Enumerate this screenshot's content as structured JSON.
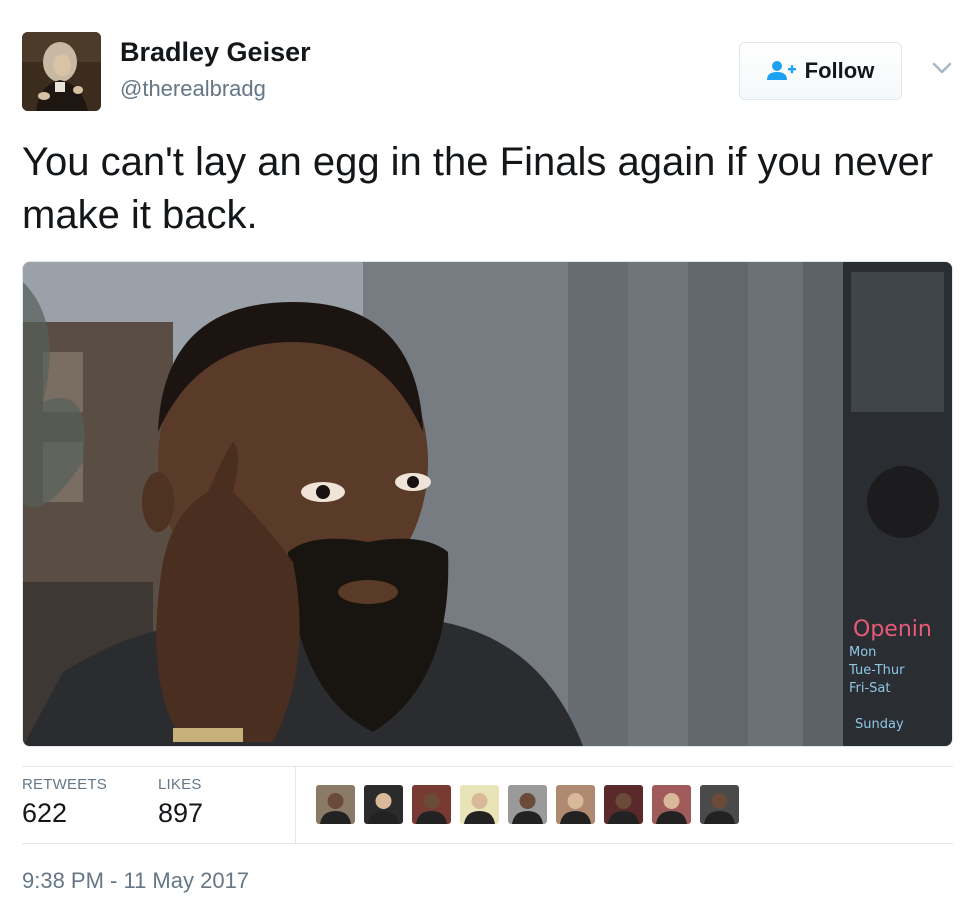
{
  "user": {
    "display_name": "Bradley Geiser",
    "handle": "@therealbradg",
    "avatar_icon": "portrait-avatar"
  },
  "follow_button": {
    "label": "Follow",
    "icon": "follow-user-icon"
  },
  "menu": {
    "icon": "chevron-down-icon"
  },
  "tweet": {
    "text": "You can't lay an egg in the Finals again if you never make it back."
  },
  "media": {
    "sign_lines": [
      "Openin",
      "Mon",
      "Tue-Thur",
      "Fri-Sat",
      "Sunday"
    ]
  },
  "stats": {
    "retweets_label": "RETWEETS",
    "retweets_value": "622",
    "likes_label": "LIKES",
    "likes_value": "897"
  },
  "likers": [
    {
      "color": "#8a7a66"
    },
    {
      "color": "#2b2b2b"
    },
    {
      "color": "#7a3a34"
    },
    {
      "color": "#e8e4b8"
    },
    {
      "color": "#9a9a9a"
    },
    {
      "color": "#b08a70"
    },
    {
      "color": "#5a2a2a"
    },
    {
      "color": "#a05a5a"
    },
    {
      "color": "#4a4a4a"
    }
  ],
  "timestamp": "9:38 PM - 11 May 2017",
  "colors": {
    "text": "#14171a",
    "secondary": "#657786",
    "accent": "#1da1f2",
    "border": "#e1e8ed"
  }
}
